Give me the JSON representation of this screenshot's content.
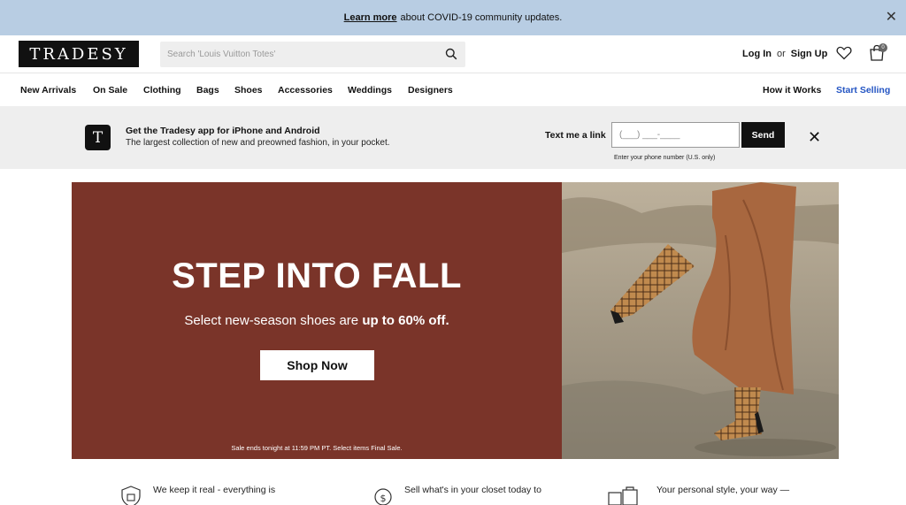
{
  "covid": {
    "link": "Learn more",
    "text": "about COVID-19 community updates."
  },
  "header": {
    "logo": "TRADESY",
    "search_placeholder": "Search 'Louis Vuitton Totes'",
    "login": "Log In",
    "or": "or",
    "signup": "Sign Up",
    "bag_count": "0"
  },
  "nav": {
    "items": [
      "New Arrivals",
      "On Sale",
      "Clothing",
      "Bags",
      "Shoes",
      "Accessories",
      "Weddings",
      "Designers"
    ],
    "how": "How it Works",
    "sell": "Start Selling"
  },
  "appbar": {
    "icon_letter": "T",
    "title": "Get the Tradesy app for iPhone and Android",
    "subtitle": "The largest collection of new and preowned fashion, in your pocket.",
    "text_label": "Text me a link",
    "phone_placeholder": "(___) ___-____",
    "send": "Send",
    "hint": "Enter your phone number (U.S. only)"
  },
  "hero": {
    "title": "STEP INTO FALL",
    "sub_prefix": "Select new-season shoes are",
    "sub_bold": "up to 60% off.",
    "button": "Shop Now",
    "note": "Sale ends tonight at 11:59 PM PT. Select items Final Sale."
  },
  "value_props": [
    "We keep it real - everything is",
    "Sell what's in your closet today to",
    "Your personal style, your way —"
  ],
  "colors": {
    "covid_bg": "#b8cde3",
    "hero_bg": "#7a3429",
    "sell_link": "#2455c3"
  }
}
